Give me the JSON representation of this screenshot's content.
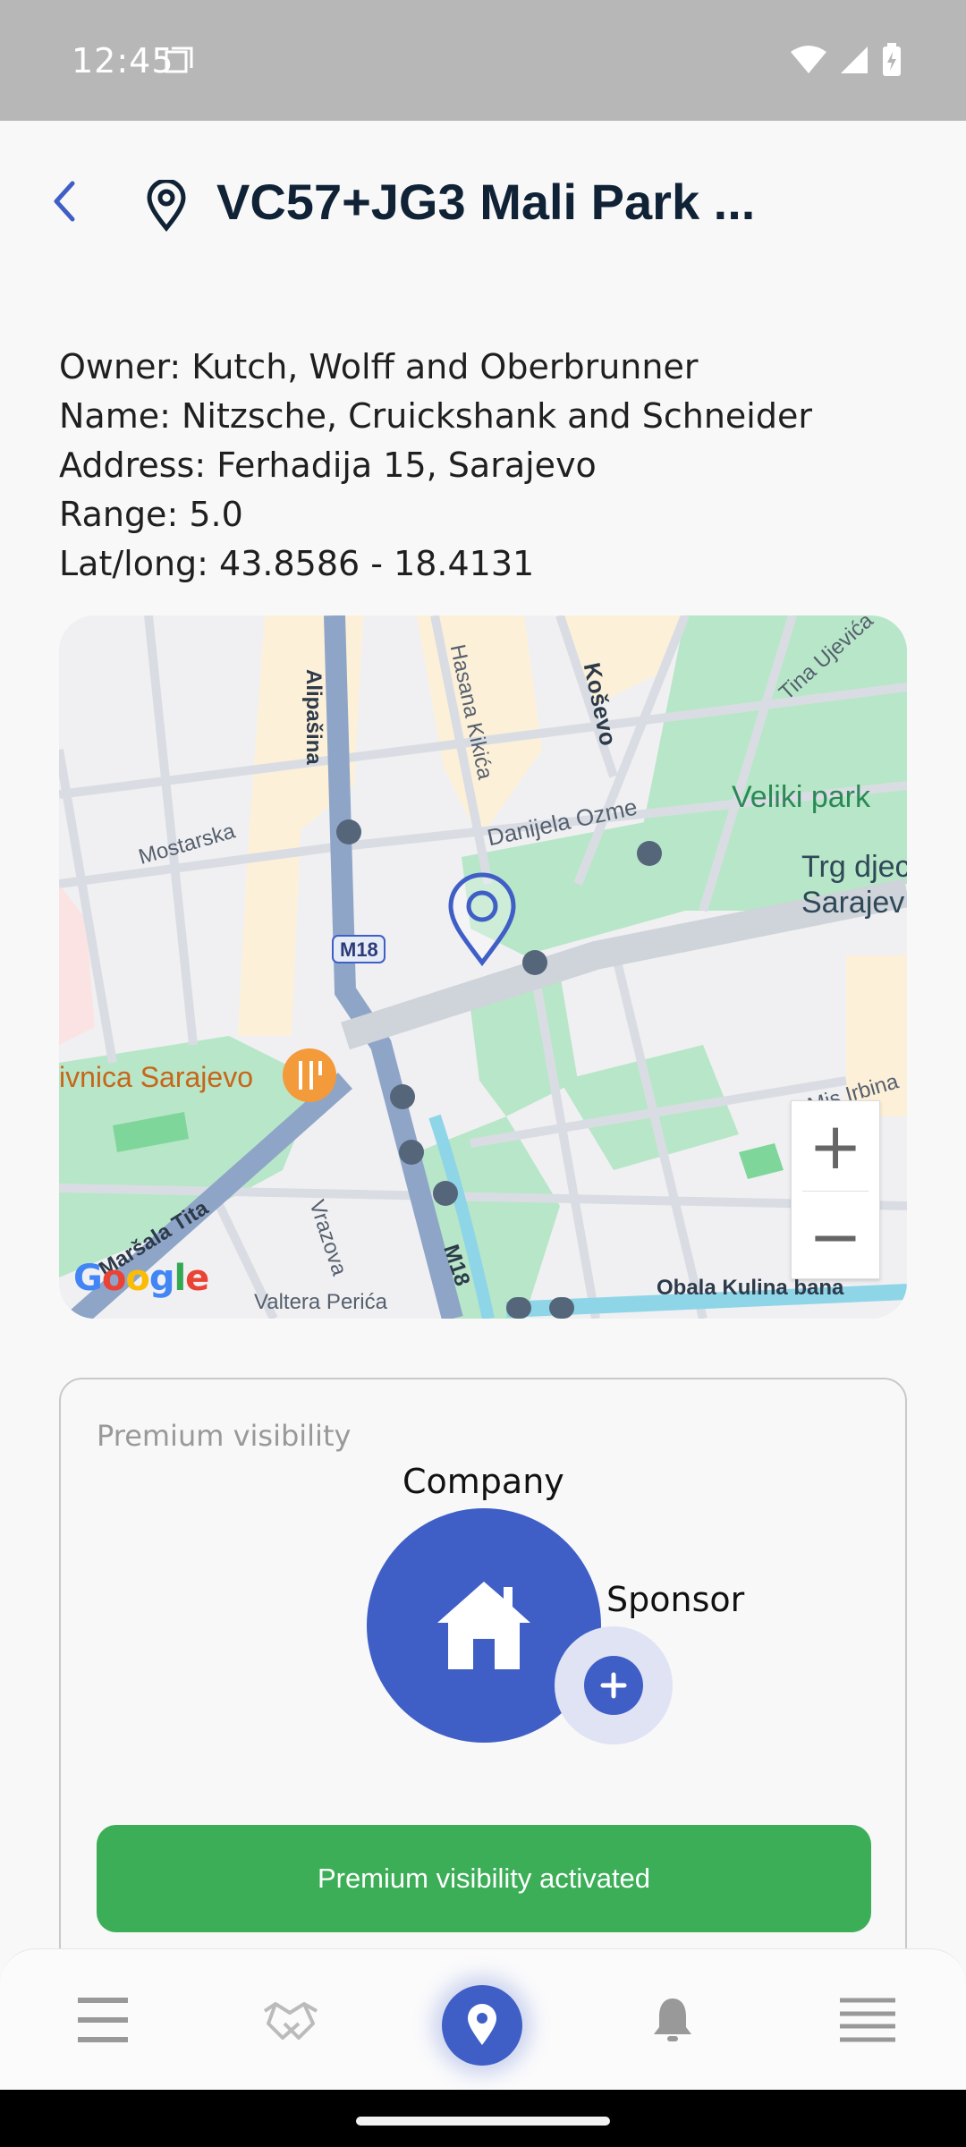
{
  "status_bar": {
    "time": "12:45"
  },
  "header": {
    "title": "VC57+JG3 Mali Park ..."
  },
  "details": {
    "owner": "Owner: Kutch, Wolff and Oberbrunner",
    "name": "Name: Nitzsche, Cruickshank and Schneider",
    "address": "Address: Ferhadija 15, Sarajevo",
    "range": "Range: 5.0",
    "latlong": "Lat/long: 43.8586 - 18.4131"
  },
  "map": {
    "labels": {
      "alipasina": "Alipašina",
      "hasana_kikica": "Hasana Kikića",
      "kosevo": "Koševo",
      "tina_ujevica": "Tina Ujevića",
      "veliki_park": "Veliki park",
      "mostarska": "Mostarska",
      "danijela_ozme": "Danijela Ozme",
      "trg_djec": "Trg djec",
      "sarajev": "Sarajev",
      "m18_a": "M18",
      "m18_b": "M18",
      "restaurant": "ivnica Sarajevo",
      "mis_irbina": "Mis Irbina",
      "marsala_tita": "Maršala Tita",
      "vrazova": "Vrazova",
      "valtera_perica": "Valtera Perića",
      "obala_kulina_bana": "Obala Kulina bana"
    },
    "zoom_in": "+",
    "zoom_out": "−",
    "colors": {
      "park": "#b8e6c8",
      "road_major": "#8ea5c7",
      "road": "#d9dde3",
      "building": "#fdf0d9",
      "water": "#8fd5e8",
      "pin": "#3f5fc7"
    }
  },
  "premium": {
    "label": "Premium visibility",
    "company_label": "Company",
    "sponsor_label": "Sponsor",
    "activated_button": "Premium visibility activated",
    "colors": {
      "accent": "#3f5fc7",
      "success": "#3cae57"
    }
  },
  "bottom_nav": {
    "items": [
      {
        "icon": "menu-icon"
      },
      {
        "icon": "handshake-icon"
      },
      {
        "icon": "location-pin-icon",
        "active": true
      },
      {
        "icon": "bell-icon"
      },
      {
        "icon": "list-icon"
      }
    ]
  }
}
